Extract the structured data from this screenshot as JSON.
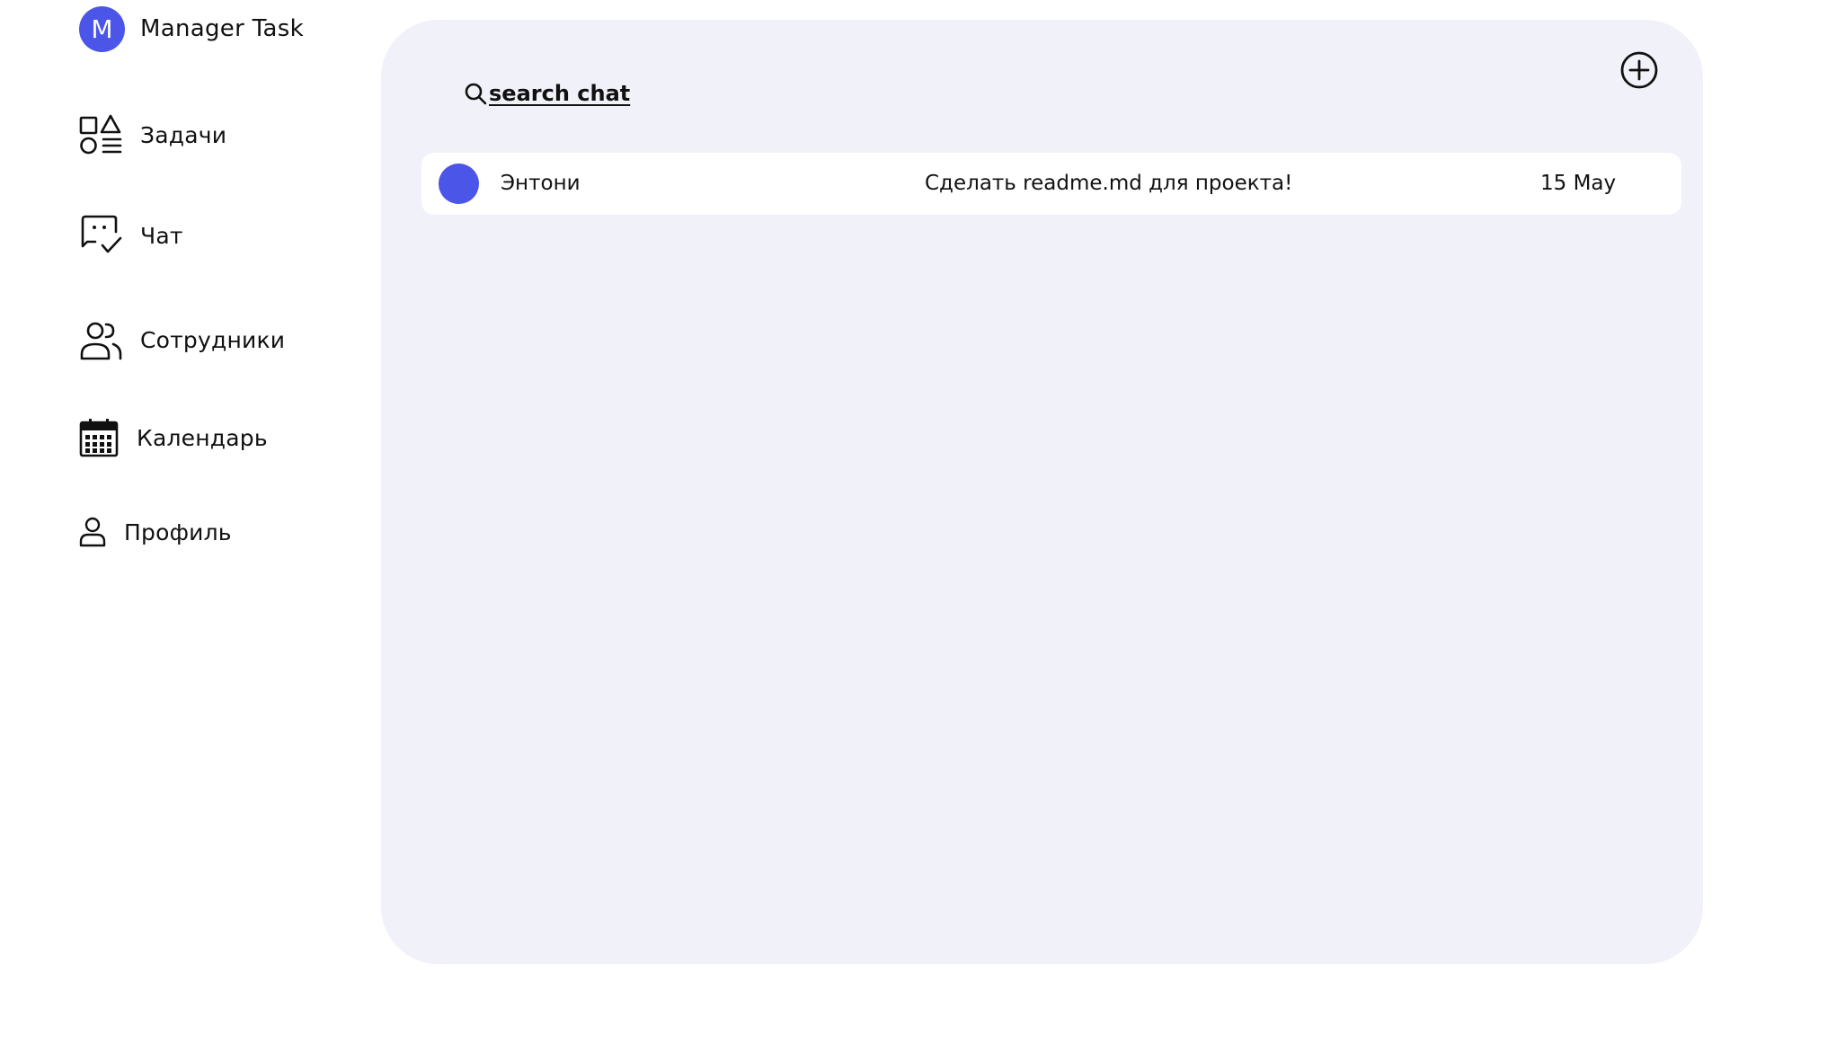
{
  "colors": {
    "accent": "#4b55e8",
    "panel_bg": "#f1f1f9",
    "row_bg": "#ffffff",
    "text": "#111111"
  },
  "brand": {
    "avatar_letter": "M",
    "title": "Manager Task"
  },
  "sidebar": {
    "items": [
      {
        "label": "Задачи",
        "icon": "tasks-shapes-icon"
      },
      {
        "label": "Чат",
        "icon": "chat-check-icon"
      },
      {
        "label": "Сотрудники",
        "icon": "users-icon"
      },
      {
        "label": "Календарь",
        "icon": "calendar-icon"
      },
      {
        "label": "Профиль",
        "icon": "profile-icon"
      }
    ]
  },
  "search": {
    "label": "search chat",
    "icon": "search-icon"
  },
  "actions": {
    "add_icon": "plus-circle-icon"
  },
  "chats": [
    {
      "name": "Энтони",
      "last_message": "Сделать readme.md для проекта!",
      "date": "15 May"
    }
  ]
}
